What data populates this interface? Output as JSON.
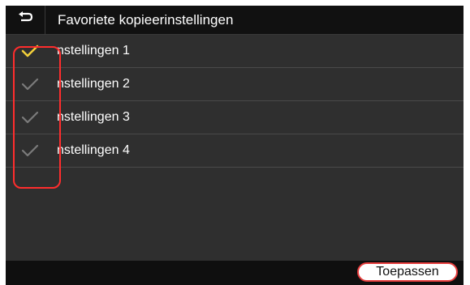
{
  "header": {
    "title": "Favoriete kopieerinstellingen",
    "back_icon": "back-arrow-icon"
  },
  "items": [
    {
      "label": "nstellingen 1",
      "selected": true
    },
    {
      "label": "nstellingen 2",
      "selected": false
    },
    {
      "label": "nstellingen 3",
      "selected": false
    },
    {
      "label": "nstellingen 4",
      "selected": false
    }
  ],
  "footer": {
    "apply_label": "Toepassen"
  },
  "colors": {
    "selected_check": "#f2cf3a",
    "unselected_check": "#7b7b7b",
    "highlight": "#ff2d2d"
  }
}
